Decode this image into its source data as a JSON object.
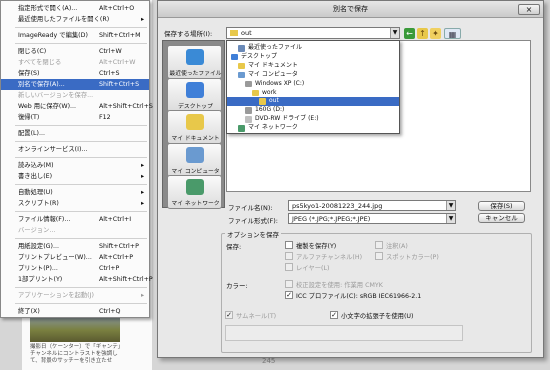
{
  "menu": {
    "items": [
      {
        "label": "指定形式で開く(A)...",
        "shortcut": "Alt+Ctrl+O",
        "state": "normal",
        "arrow": false
      },
      {
        "label": "最近使用したファイルを開く(R)",
        "shortcut": "",
        "state": "normal",
        "arrow": true
      },
      {
        "sep": true
      },
      {
        "label": "ImageReady で編集(D)",
        "shortcut": "Shift+Ctrl+M",
        "state": "normal",
        "arrow": false
      },
      {
        "sep": true
      },
      {
        "label": "閉じる(C)",
        "shortcut": "Ctrl+W",
        "state": "normal",
        "arrow": false
      },
      {
        "label": "すべてを閉じる",
        "shortcut": "Alt+Ctrl+W",
        "state": "disabled",
        "arrow": false
      },
      {
        "label": "保存(S)",
        "shortcut": "Ctrl+S",
        "state": "normal",
        "arrow": false
      },
      {
        "label": "別名で保存(A)...",
        "shortcut": "Shift+Ctrl+S",
        "state": "highlighted",
        "arrow": false
      },
      {
        "label": "新しいバージョンを保存...",
        "shortcut": "",
        "state": "disabled",
        "arrow": false
      },
      {
        "label": "Web 用に保存(W)...",
        "shortcut": "Alt+Shift+Ctrl+S",
        "state": "normal",
        "arrow": false
      },
      {
        "label": "復帰(T)",
        "shortcut": "F12",
        "state": "normal",
        "arrow": false
      },
      {
        "sep": true
      },
      {
        "label": "配置(L)...",
        "shortcut": "",
        "state": "normal",
        "arrow": false
      },
      {
        "sep": true
      },
      {
        "label": "オンラインサービス(I)...",
        "shortcut": "",
        "state": "normal",
        "arrow": false
      },
      {
        "sep": true
      },
      {
        "label": "読み込み(M)",
        "shortcut": "",
        "state": "normal",
        "arrow": true
      },
      {
        "label": "書き出し(E)",
        "shortcut": "",
        "state": "normal",
        "arrow": true
      },
      {
        "sep": true
      },
      {
        "label": "自動処理(U)",
        "shortcut": "",
        "state": "normal",
        "arrow": true
      },
      {
        "label": "スクリプト(R)",
        "shortcut": "",
        "state": "normal",
        "arrow": true
      },
      {
        "sep": true
      },
      {
        "label": "ファイル情報(F)...",
        "shortcut": "Alt+Ctrl+I",
        "state": "normal",
        "arrow": false
      },
      {
        "label": "バージョン...",
        "shortcut": "",
        "state": "disabled",
        "arrow": false
      },
      {
        "sep": true
      },
      {
        "label": "用紙設定(G)...",
        "shortcut": "Shift+Ctrl+P",
        "state": "normal",
        "arrow": false
      },
      {
        "label": "プリントプレビュー(W)...",
        "shortcut": "Alt+Ctrl+P",
        "state": "normal",
        "arrow": false
      },
      {
        "label": "プリント(P)...",
        "shortcut": "Ctrl+P",
        "state": "normal",
        "arrow": false
      },
      {
        "label": "1部プリント(Y)",
        "shortcut": "Alt+Shift+Ctrl+P",
        "state": "normal",
        "arrow": false
      },
      {
        "sep": true
      },
      {
        "label": "アプリケーションを起動(J)",
        "shortcut": "",
        "state": "disabled",
        "arrow": true
      },
      {
        "sep": true
      },
      {
        "label": "終了(X)",
        "shortcut": "Ctrl+Q",
        "state": "normal",
        "arrow": false
      }
    ]
  },
  "background": {
    "caption": "撮影日（ケーンター）で「ギャンテ」チャンネルにコントラストを強調して、背景のサッチーを引き立たせ",
    "page_number": "245"
  },
  "dialog": {
    "title": "別名で保存",
    "close_glyph": "×",
    "save_in_label": "保存する場所(I):",
    "save_in_value": "out",
    "places": [
      {
        "label": "最近使ったファイル",
        "icon": "recent-files-icon",
        "color": "#3a8ad6"
      },
      {
        "label": "デスクトップ",
        "icon": "desktop-icon",
        "color": "#3f7fd8"
      },
      {
        "label": "マイ ドキュメント",
        "icon": "my-documents-icon",
        "color": "#e8c84a"
      },
      {
        "label": "マイ コンピュータ",
        "icon": "my-computer-icon",
        "color": "#6a9ad0"
      },
      {
        "label": "マイ ネットワーク",
        "icon": "my-network-icon",
        "color": "#4a9a6a"
      }
    ],
    "location_dropdown": [
      {
        "label": "最近使ったファイル",
        "indent": 1,
        "color": "#6a8ab8",
        "selected": false
      },
      {
        "label": "デスクトップ",
        "indent": 0,
        "color": "#3f7fd8",
        "selected": false
      },
      {
        "label": "マイ ドキュメント",
        "indent": 1,
        "color": "#e8c84a",
        "selected": false
      },
      {
        "label": "マイ コンピュータ",
        "indent": 1,
        "color": "#6a9ad0",
        "selected": false
      },
      {
        "label": "Windows XP (C:)",
        "indent": 2,
        "color": "#9a9a9a",
        "selected": false
      },
      {
        "label": "work",
        "indent": 3,
        "color": "#e8c84a",
        "selected": false
      },
      {
        "label": "out",
        "indent": 4,
        "color": "#e8c84a",
        "selected": true
      },
      {
        "label": "160G (D:)",
        "indent": 2,
        "color": "#9a9a9a",
        "selected": false
      },
      {
        "label": "DVD-RW ドライブ (E:)",
        "indent": 2,
        "color": "#c0c0c0",
        "selected": false
      },
      {
        "label": "マイ ネットワーク",
        "indent": 1,
        "color": "#4a9a6a",
        "selected": false
      }
    ],
    "filename_label": "ファイル名(N):",
    "filename_value": "ps5kyo1-20081223_244.jpg",
    "filetype_label": "ファイル形式(F):",
    "filetype_value": "JPEG (*.JPG;*.JPEG;*.JPE)",
    "save_button": "保存(S)",
    "cancel_button": "キャンセル",
    "options_title": "オプションを保存",
    "save_label": "保存:",
    "options": [
      {
        "label": "複製を保存(Y)",
        "checked": false,
        "enabled": true
      },
      {
        "label": "注釈(A)",
        "checked": false,
        "enabled": false
      },
      {
        "label": "アルファチャンネル(H)",
        "checked": false,
        "enabled": false
      },
      {
        "label": "スポットカラー(P)",
        "checked": false,
        "enabled": false
      },
      {
        "label": "レイヤー(L)",
        "checked": false,
        "enabled": false
      }
    ],
    "color_label": "カラー:",
    "proof_label": "校正設定を使用: 作業用 CMYK",
    "icc_label": "ICC プロファイル(C): sRGB IEC61966-2.1",
    "icc_checked": true,
    "thumbnail_label": "サムネール(T)",
    "lowercase_label": "小文字の拡張子を使用(U)",
    "lowercase_checked": true,
    "check_glyph": "✓",
    "accent_color": "#3a6bc4"
  }
}
